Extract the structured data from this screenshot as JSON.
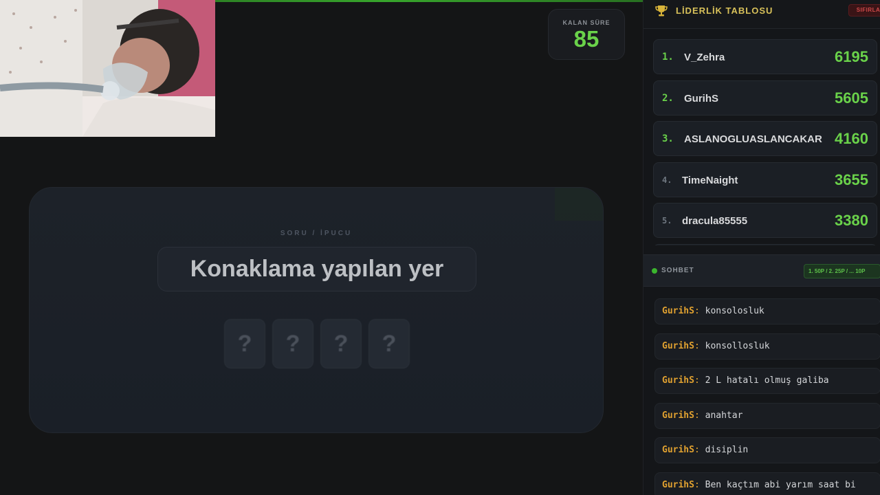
{
  "timer": {
    "label": "KALAN SÜRE",
    "value": "85"
  },
  "question": {
    "label": "SORU / İPUCU",
    "text": "Konaklama yapılan yer",
    "tiles": [
      "?",
      "?",
      "?",
      "?"
    ]
  },
  "leaderboard": {
    "title": "LİDERLİK TABLOSU",
    "reset_label": "SIFIRLA",
    "rows": [
      {
        "rank": "1.",
        "name": "V_Zehra",
        "score": "6195"
      },
      {
        "rank": "2.",
        "name": "GurihS",
        "score": "5605"
      },
      {
        "rank": "3.",
        "name": "ASLANOGLUASLANCAKAR",
        "score": "4160"
      },
      {
        "rank": "4.",
        "name": "TimeNaight",
        "score": "3655"
      },
      {
        "rank": "5.",
        "name": "dracula85555",
        "score": "3380"
      }
    ]
  },
  "chat": {
    "title": "SOHBET",
    "points_badge": "1. 50P / 2. 25P / ... 10P",
    "messages": [
      {
        "user": "GurihS",
        "text": "konsolosluk"
      },
      {
        "user": "GurihS",
        "text": "konsollosluk"
      },
      {
        "user": "GurihS",
        "text": "2 L hatalı olmuş galiba"
      },
      {
        "user": "GurihS",
        "text": "anahtar"
      },
      {
        "user": "GurihS",
        "text": "disiplin"
      },
      {
        "user": "GurihS",
        "text": "Ben kaçtım abi yarım saat bi"
      }
    ]
  },
  "colors": {
    "accent": "#6ad24a",
    "username": "#e0a130",
    "danger": "#d24a4a",
    "title_gold": "#d8c15a"
  },
  "icons": {
    "leaderboard": "trophy-icon",
    "chat_status": "live-dot-icon"
  }
}
